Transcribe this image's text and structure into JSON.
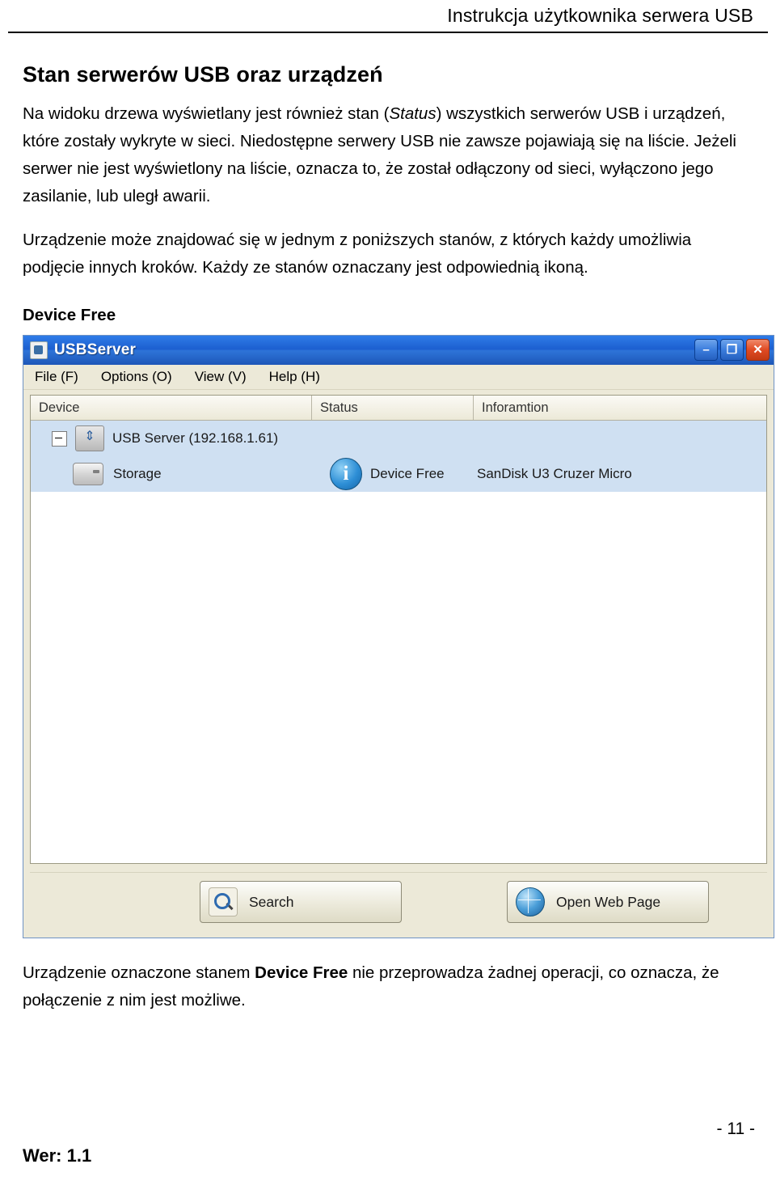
{
  "header": {
    "running_title": "Instrukcja użytkownika serwera USB"
  },
  "section": {
    "title": "Stan serwerów USB oraz urządzeń",
    "paragraph1_a": "Na widoku drzewa wyświetlany jest również stan (",
    "paragraph1_em": "Status",
    "paragraph1_b": ") wszystkich serwerów USB i urządzeń, które zostały wykryte w sieci. Niedostępne serwery USB nie zawsze pojawiają się na liście. Jeżeli serwer nie jest wyświetlony na liście, oznacza to, że został odłączony od sieci, wyłączono jego zasilanie, lub uległ awarii.",
    "paragraph2": "Urządzenie może znajdować się w jednym z poniższych stanów, z których każdy umożliwia podjęcie innych kroków. Każdy ze stanów oznaczany jest odpowiednią ikoną.",
    "subhead": "Device Free"
  },
  "app": {
    "title": "USBServer",
    "window_buttons": {
      "minimize": "–",
      "maximize": "❐",
      "close": "✕"
    },
    "menu": [
      "File (F)",
      "Options (O)",
      "View (V)",
      "Help (H)"
    ],
    "columns": [
      "Device",
      "Status",
      "Inforamtion"
    ],
    "rows": [
      {
        "device": "USB Server (192.168.1.61)",
        "status": "",
        "information": "",
        "type": "server"
      },
      {
        "device": "Storage",
        "status": "Device Free",
        "information": "SanDisk U3 Cruzer Micro",
        "type": "device"
      }
    ],
    "buttons": {
      "search": "Search",
      "open_web_page": "Open Web Page"
    },
    "info_icon_glyph": "i"
  },
  "closing": {
    "text_a": "Urządzenie oznaczone stanem ",
    "bold": "Device Free",
    "text_b": " nie przeprowadza żadnej operacji, co oznacza, że połączenie z nim jest możliwe."
  },
  "footer": {
    "page_number": "- 11 -",
    "version": "Wer: 1.1"
  }
}
